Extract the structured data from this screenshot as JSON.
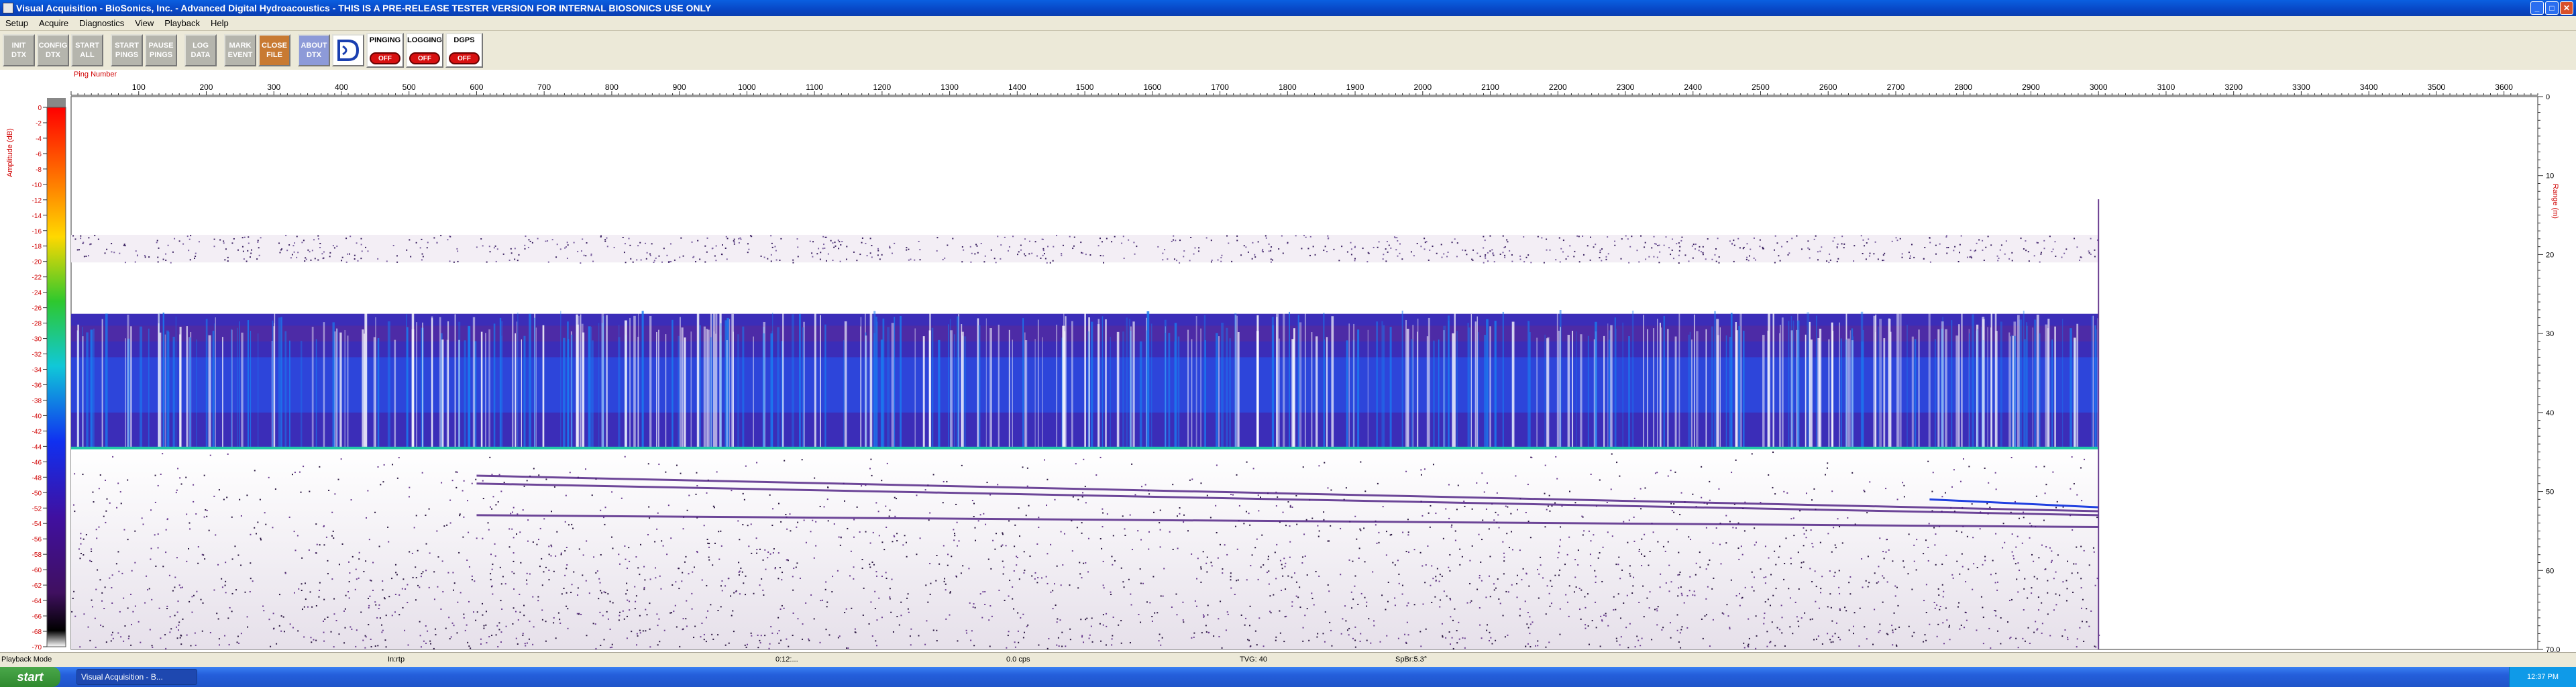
{
  "window": {
    "title": "Visual Acquisition  -  BioSonics, Inc.  -  Advanced Digital Hydroacoustics  -  THIS IS A PRE-RELEASE TESTER VERSION FOR INTERNAL BIOSONICS USE ONLY"
  },
  "menu": [
    "Setup",
    "Acquire",
    "Diagnostics",
    "View",
    "Playback",
    "Help"
  ],
  "toolbar": {
    "buttons": [
      "INIT\nDTX",
      "CONFIG\nDTX",
      "START\nALL",
      "START\nPINGS",
      "PAUSE\nPINGS",
      "LOG\nDATA",
      "MARK\nEVENT",
      "CLOSE\nFILE",
      "ABOUT\nDTX"
    ],
    "status": [
      {
        "label": "PINGING",
        "state": "OFF"
      },
      {
        "label": "LOGGING",
        "state": "OFF"
      },
      {
        "label": "DGPS",
        "state": "OFF"
      }
    ]
  },
  "plot": {
    "x_label": "Ping Number",
    "left_label": "Amplitude (dB)",
    "right_label": "Range (m)",
    "x_ticks": [
      100,
      200,
      300,
      400,
      500,
      600,
      700,
      800,
      900,
      1000,
      1100,
      1200,
      1300,
      1400,
      1500,
      1600,
      1700,
      1800,
      1900,
      2000,
      2100,
      2200,
      2300,
      2400,
      2500,
      2600,
      2700,
      2800,
      2900,
      3000,
      3100,
      3200,
      3300,
      3400,
      3500,
      3600
    ],
    "x_range": [
      0,
      3650
    ],
    "amp_ticks": [
      0,
      -2,
      -4,
      -6,
      -8,
      -10,
      -12,
      -14,
      -16,
      -18,
      -20,
      -22,
      -24,
      -26,
      -28,
      -30,
      -32,
      -34,
      -36,
      -38,
      -40,
      -42,
      -44,
      -46,
      -48,
      -50,
      -52,
      -54,
      -56,
      -58,
      -60,
      -62,
      -64,
      -66,
      -68,
      -70
    ],
    "range_ticks": [
      0,
      10,
      20,
      30,
      40,
      50,
      60,
      70
    ],
    "range_max": 70,
    "last_ping": 3000,
    "bottom_depth": 44.5,
    "colors": {
      "axis": "#d00000",
      "bottom": "#22c8a8"
    }
  },
  "status_bar": {
    "mode": "Playback Mode",
    "field1": "In:rtp",
    "field2": "0:12:...",
    "field3": "0.0 cps",
    "field4": "TVG: 40",
    "field5": "SpBr:5.3°"
  },
  "taskbar": {
    "start": "start",
    "item": "Visual Acquisition - B...",
    "clock": "12:37 PM"
  }
}
